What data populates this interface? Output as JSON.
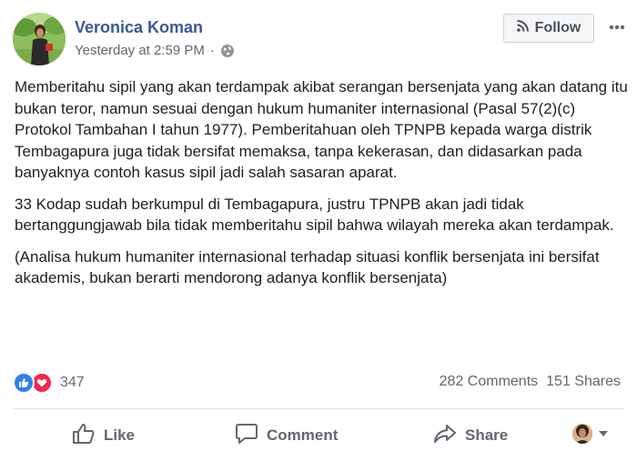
{
  "post": {
    "author": "Veronica Koman",
    "timestamp": "Yesterday at 2:59 PM",
    "separator": "·",
    "privacy_icon": "globe-icon",
    "follow_label": "Follow",
    "paragraphs": [
      "Memberitahu sipil yang akan terdampak akibat serangan bersenjata yang akan datang itu bukan teror, namun sesuai dengan hukum humaniter internasional (Pasal 57(2)(c) Protokol Tambahan I tahun 1977). Pemberitahuan oleh TPNPB kepada warga distrik Tembagapura juga tidak bersifat memaksa, tanpa kekerasan, dan didasarkan pada banyaknya contoh kasus sipil jadi salah sasaran aparat.",
      "33 Kodap sudah berkumpul di Tembagapura, justru TPNPB akan jadi tidak bertanggungjawab bila tidak memberitahu sipil bahwa wilayah mereka akan terdampak.",
      "(Analisa hukum humaniter internasional terhadap situasi konflik bersenjata ini bersifat akademis, bukan berarti mendorong adanya konflik bersenjata)"
    ]
  },
  "engagement": {
    "reaction_count": "347",
    "reaction_icons": [
      "like-icon",
      "love-icon"
    ],
    "comments": "282 Comments",
    "shares": "151 Shares"
  },
  "actions": {
    "like": "Like",
    "comment": "Comment",
    "share": "Share"
  },
  "colors": {
    "author_link": "#385898",
    "like_blue": "#2f80ed",
    "love_red": "#f0284a",
    "muted_text": "#616770"
  }
}
